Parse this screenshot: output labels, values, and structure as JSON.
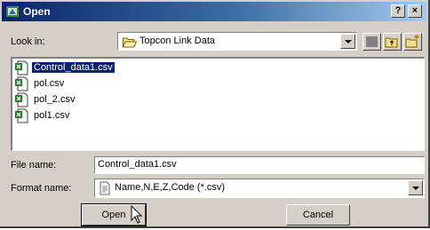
{
  "window": {
    "title": "Open",
    "help_label": "?",
    "close_label": "×"
  },
  "look_in": {
    "label": "Look in:",
    "value": "Topcon Link Data"
  },
  "toolbar": {
    "icons": [
      "view-menu-icon",
      "up-one-level-icon",
      "new-folder-icon"
    ]
  },
  "files": [
    {
      "name": "Control_data1.csv",
      "selected": true
    },
    {
      "name": "pol.csv"
    },
    {
      "name": "pol_2.csv"
    },
    {
      "name": "pol1.csv"
    }
  ],
  "file_name": {
    "label": "File name:",
    "value": "Control_data1.csv"
  },
  "format_name": {
    "label": "Format name:",
    "value": "Name,N,E,Z,Code (*.csv)"
  },
  "buttons": {
    "open": "Open",
    "cancel": "Cancel"
  },
  "colors": {
    "title_bar": "#0a246a",
    "selection": "#0a246a",
    "face": "#d4d0c8"
  }
}
